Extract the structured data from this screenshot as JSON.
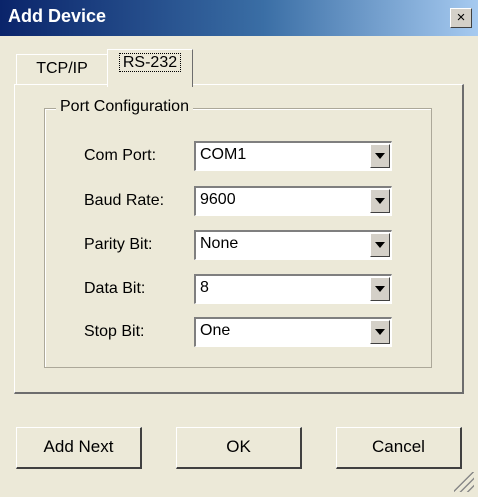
{
  "window": {
    "title": "Add Device",
    "close_label": "×"
  },
  "tabs": [
    {
      "label": "TCP/IP",
      "selected": false
    },
    {
      "label": "RS-232",
      "selected": true
    }
  ],
  "group": {
    "title": "Port Configuration"
  },
  "fields": [
    {
      "label": "Com Port:",
      "value": "COM1"
    },
    {
      "label": "Baud Rate:",
      "value": "9600"
    },
    {
      "label": "Parity Bit:",
      "value": "None"
    },
    {
      "label": "Data Bit:",
      "value": "8"
    },
    {
      "label": "Stop Bit:",
      "value": "One"
    }
  ],
  "buttons": {
    "add_next": "Add Next",
    "ok": "OK",
    "cancel": "Cancel"
  }
}
